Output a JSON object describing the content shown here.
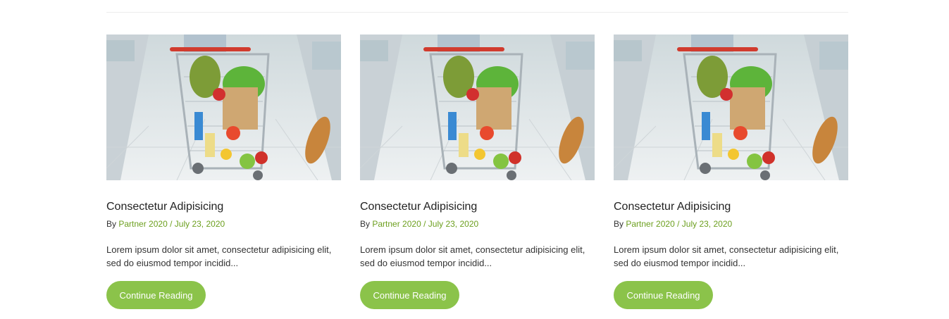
{
  "posts": [
    {
      "image_icon": "shopping-cart-photo",
      "title": "Consectetur Adipisicing",
      "by_label": "By",
      "author": "Partner 2020",
      "separator": "/",
      "date": "July 23, 2020",
      "excerpt": "Lorem ipsum dolor sit amet, consectetur adipisicing elit, sed do eiusmod tempor incidid...",
      "button_label": "Continue Reading"
    },
    {
      "image_icon": "shopping-cart-photo",
      "title": "Consectetur Adipisicing",
      "by_label": "By",
      "author": "Partner 2020",
      "separator": "/",
      "date": "July 23, 2020",
      "excerpt": "Lorem ipsum dolor sit amet, consectetur adipisicing elit, sed do eiusmod tempor incidid...",
      "button_label": "Continue Reading"
    },
    {
      "image_icon": "shopping-cart-photo",
      "title": "Consectetur Adipisicing",
      "by_label": "By",
      "author": "Partner 2020",
      "separator": "/",
      "date": "July 23, 2020",
      "excerpt": "Lorem ipsum dolor sit amet, consectetur adipisicing elit, sed do eiusmod tempor incidid...",
      "button_label": "Continue Reading"
    }
  ],
  "colors": {
    "accent_link": "#6c9f1e",
    "button_bg": "#8bc34a",
    "button_text": "#ffffff"
  }
}
